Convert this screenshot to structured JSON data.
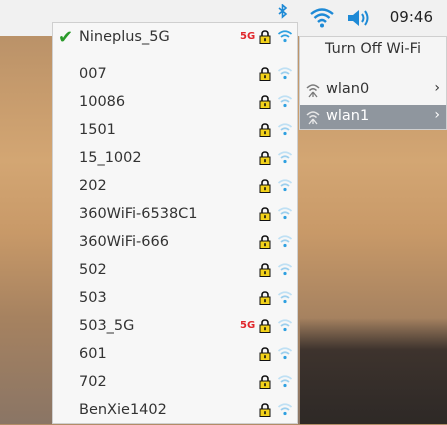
{
  "taskbar": {
    "clock": "09:46",
    "icons": [
      "bluetooth-icon",
      "wifi-icon",
      "volume-icon"
    ],
    "accent": "#1e8ad6"
  },
  "network_menu": {
    "networks": [
      {
        "name": "Nineplus_5G",
        "connected": true,
        "band": "5G",
        "locked": true
      },
      {
        "name": "007",
        "connected": false,
        "band": "",
        "locked": true
      },
      {
        "name": "10086",
        "connected": false,
        "band": "",
        "locked": true
      },
      {
        "name": "1501",
        "connected": false,
        "band": "",
        "locked": true
      },
      {
        "name": "15_1002",
        "connected": false,
        "band": "",
        "locked": true
      },
      {
        "name": "202",
        "connected": false,
        "band": "",
        "locked": true
      },
      {
        "name": "360WiFi-6538C1",
        "connected": false,
        "band": "",
        "locked": true
      },
      {
        "name": "360WiFi-666",
        "connected": false,
        "band": "",
        "locked": true
      },
      {
        "name": "502",
        "connected": false,
        "band": "",
        "locked": true
      },
      {
        "name": "503",
        "connected": false,
        "band": "",
        "locked": true
      },
      {
        "name": "503_5G",
        "connected": false,
        "band": "5G",
        "locked": true
      },
      {
        "name": "601",
        "connected": false,
        "band": "",
        "locked": true
      },
      {
        "name": "702",
        "connected": false,
        "band": "",
        "locked": true
      },
      {
        "name": "BenXie1402",
        "connected": false,
        "band": "",
        "locked": true
      }
    ],
    "check_symbol": "✔"
  },
  "interface_menu": {
    "turn_off_label": "Turn Off Wi-Fi",
    "interfaces": [
      {
        "label": "wlan0",
        "selected": false,
        "arrow": "›"
      },
      {
        "label": "wlan1",
        "selected": true,
        "arrow": "›"
      }
    ]
  }
}
